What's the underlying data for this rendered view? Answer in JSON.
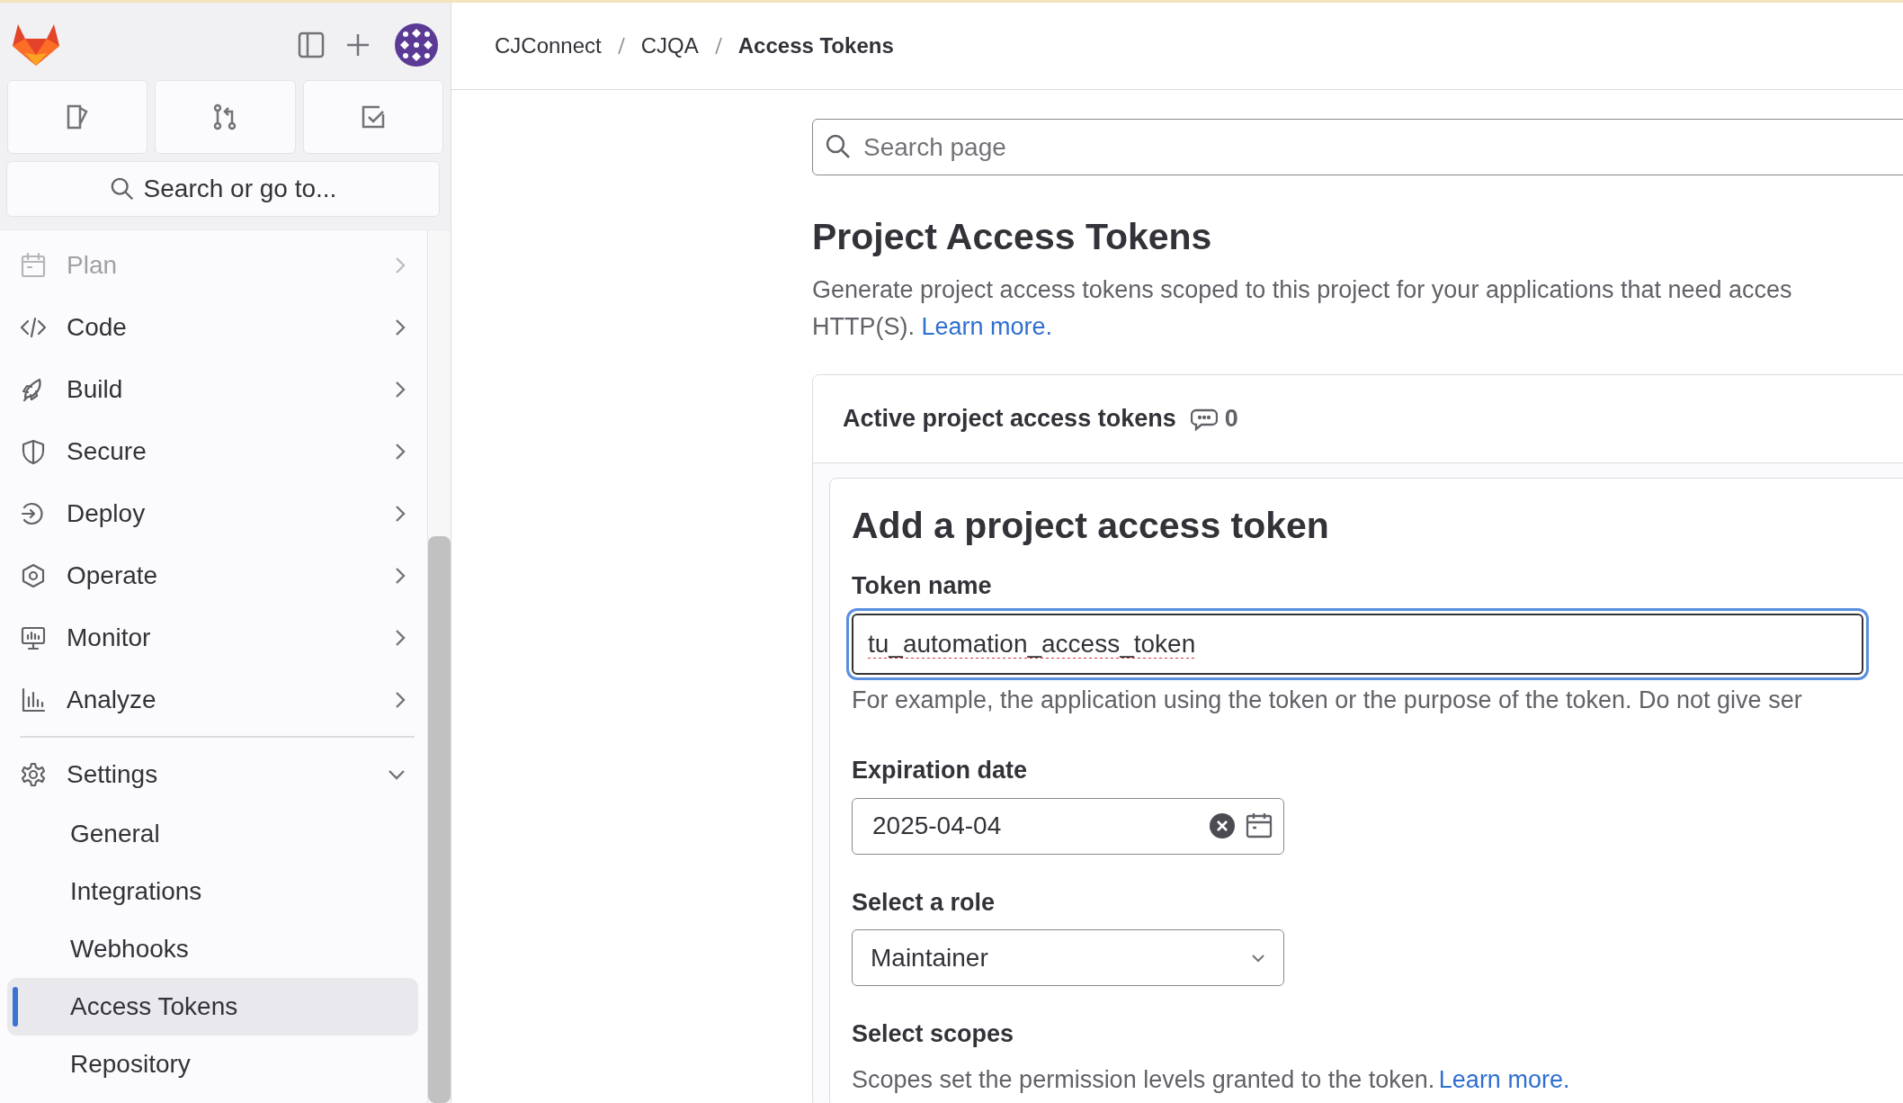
{
  "sidebar": {
    "search_button": "Search or go to...",
    "nav": [
      {
        "label": "Plan",
        "expanded": false
      },
      {
        "label": "Code",
        "expanded": false
      },
      {
        "label": "Build",
        "expanded": false
      },
      {
        "label": "Secure",
        "expanded": false
      },
      {
        "label": "Deploy",
        "expanded": false
      },
      {
        "label": "Operate",
        "expanded": false
      },
      {
        "label": "Monitor",
        "expanded": false
      },
      {
        "label": "Analyze",
        "expanded": false
      },
      {
        "label": "Settings",
        "expanded": true,
        "children": [
          {
            "label": "General",
            "selected": false
          },
          {
            "label": "Integrations",
            "selected": false
          },
          {
            "label": "Webhooks",
            "selected": false
          },
          {
            "label": "Access Tokens",
            "selected": true
          },
          {
            "label": "Repository",
            "selected": false
          }
        ]
      }
    ]
  },
  "breadcrumb": [
    "CJConnect",
    "CJQA",
    "Access Tokens"
  ],
  "search": {
    "placeholder": "Search page"
  },
  "page_title": "Project Access Tokens",
  "description_lines": [
    "Generate project access tokens scoped to this project for your applications that need acces",
    "HTTP(S)."
  ],
  "description_link": "Learn more.",
  "active_tokens": {
    "title": "Active project access tokens",
    "count": "0"
  },
  "form": {
    "title": "Add a project access token",
    "fields": [
      {
        "kind": "text",
        "label": "Token name",
        "value": "tu_automation_access_token",
        "focused": true,
        "help": "For example, the application using the token or the purpose of the token. Do not give ser"
      },
      {
        "kind": "date",
        "label": "Expiration date",
        "value": "2025-04-04"
      },
      {
        "kind": "select",
        "label": "Select a role",
        "value": "Maintainer"
      },
      {
        "kind": "scopes",
        "label": "Select scopes",
        "help": "Scopes set the permission levels granted to the token.",
        "link": "Learn more."
      }
    ]
  }
}
